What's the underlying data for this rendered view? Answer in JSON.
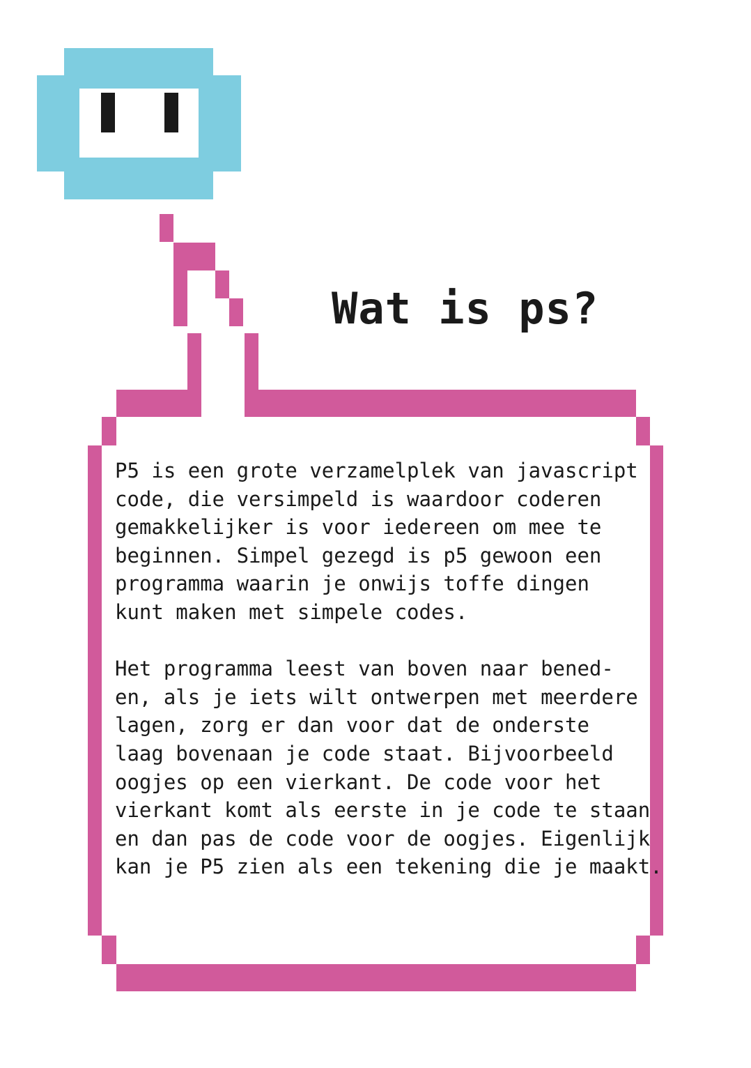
{
  "title": "Wat is ps?",
  "paragraphs": [
    [
      "P5 is een grote verzamelplek van javascript",
      "code, die versimpeld is waardoor coderen",
      "gemakkelijker is voor iedereen om mee te",
      "beginnen. Simpel gezegd is p5 gewoon een",
      "programma waarin je onwijs toffe dingen",
      "kunt maken met simpele codes."
    ],
    [
      "Het programma leest van boven naar bened-",
      "en, als je iets wilt ontwerpen met meerdere",
      "lagen, zorg er dan voor dat de onderste",
      "laag bovenaan je code staat. Bijvoorbeeld",
      "oogjes op een vierkant. De code voor het",
      "vierkant komt als eerste in je code te staan",
      "en dan pas de code voor de oogjes. Eigenlijk",
      "kan je P5 zien als een tekening die je maakt."
    ]
  ],
  "colors": {
    "robot": "#7ecde0",
    "bubble": "#d15a9b",
    "text": "#1a1a1a"
  }
}
